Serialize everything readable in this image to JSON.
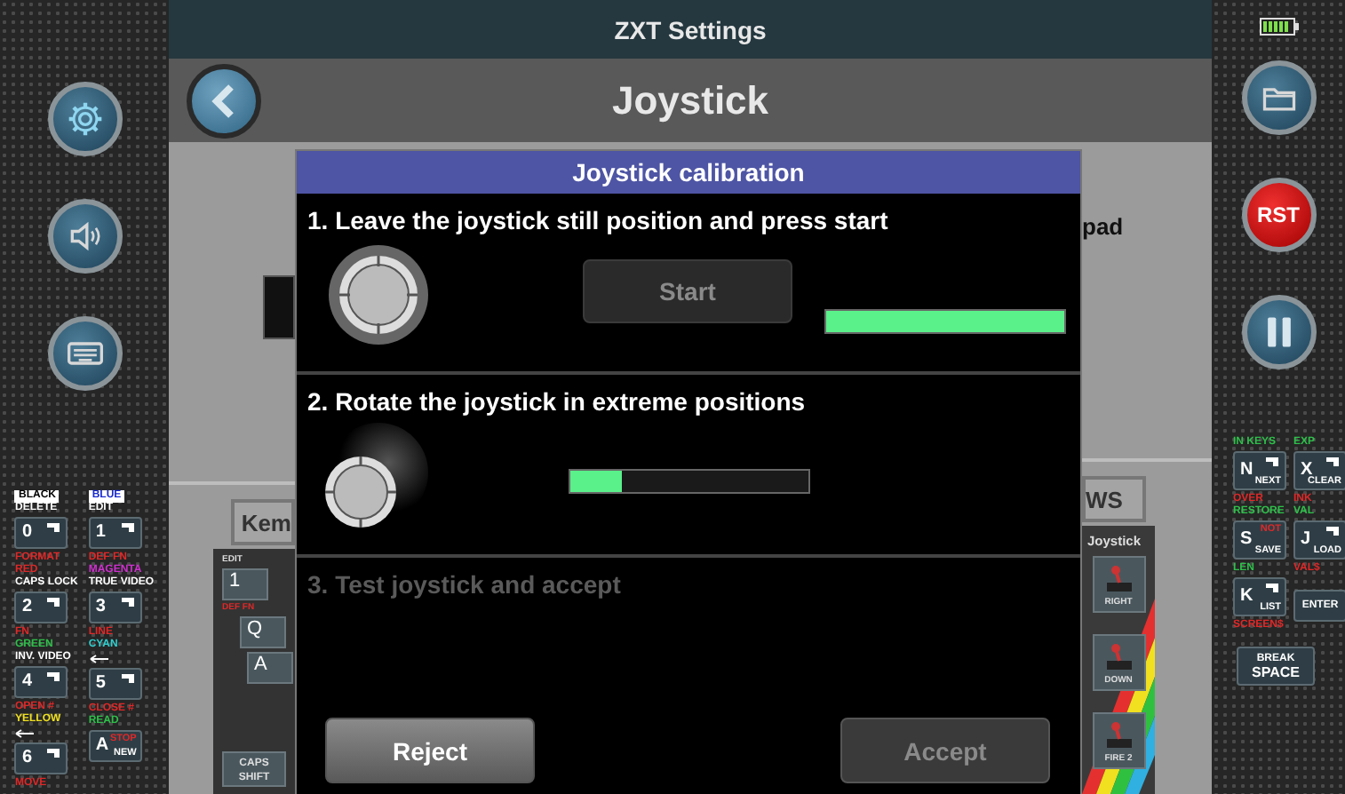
{
  "status_bar": {
    "title": "ZXT Settings"
  },
  "header": {
    "title": "Joystick"
  },
  "reset_button": {
    "label": "RST"
  },
  "keyboard_left": {
    "columns": [
      [
        {
          "kind": "tag",
          "text": "BLACK",
          "color": "#000000"
        },
        {
          "kind": "label",
          "text": "DELETE",
          "color": "#ffffff"
        },
        {
          "kind": "key",
          "key": "0"
        },
        {
          "kind": "label",
          "text": "FORMAT",
          "color": "#e02828"
        },
        {
          "kind": "label",
          "text": "RED",
          "color": "#e02828"
        },
        {
          "kind": "label",
          "text": "CAPS LOCK",
          "color": "#ffffff"
        },
        {
          "kind": "key",
          "key": "2"
        },
        {
          "kind": "label",
          "text": "FN",
          "color": "#e02828"
        },
        {
          "kind": "label",
          "text": "GREEN",
          "color": "#2ec04a"
        },
        {
          "kind": "label",
          "text": "INV. VIDEO",
          "color": "#ffffff"
        },
        {
          "kind": "key",
          "key": "4"
        },
        {
          "kind": "label",
          "text": "OPEN #",
          "color": "#e02828"
        },
        {
          "kind": "label",
          "text": "YELLOW",
          "color": "#f0e020"
        },
        {
          "kind": "arrow"
        },
        {
          "kind": "key",
          "key": "6"
        },
        {
          "kind": "label",
          "text": "MOVE",
          "color": "#e02828"
        }
      ],
      [
        {
          "kind": "tag",
          "text": "BLUE",
          "color": "#1a2ad0"
        },
        {
          "kind": "label",
          "text": "EDIT",
          "color": "#ffffff"
        },
        {
          "kind": "key",
          "key": "1"
        },
        {
          "kind": "label",
          "text": "DEF FN",
          "color": "#e02828"
        },
        {
          "kind": "label",
          "text": "MAGENTA",
          "color": "#d030d0"
        },
        {
          "kind": "label",
          "text": "TRUE VIDEO",
          "color": "#ffffff"
        },
        {
          "kind": "key",
          "key": "3"
        },
        {
          "kind": "label",
          "text": "LINE",
          "color": "#e02828"
        },
        {
          "kind": "label",
          "text": "CYAN",
          "color": "#30d0d0"
        },
        {
          "kind": "arrow"
        },
        {
          "kind": "key",
          "key": "5"
        },
        {
          "kind": "label",
          "text": "CLOSE #",
          "color": "#e02828"
        },
        {
          "kind": "label",
          "text": "READ",
          "color": "#2ec04a"
        },
        {
          "kind": "key",
          "key": "A",
          "top": "STOP",
          "bottom": "NEW"
        }
      ]
    ]
  },
  "keyboard_right": {
    "columns": [
      [
        {
          "kind": "label",
          "text": "IN KEYS",
          "color": "#2ec04a"
        },
        {
          "kind": "key",
          "key": "N",
          "bottom": "NEXT"
        },
        {
          "kind": "label",
          "text": "OVER",
          "color": "#e02828"
        },
        {
          "kind": "label",
          "text": "RESTORE",
          "color": "#2ec04a"
        },
        {
          "kind": "key",
          "key": "S",
          "top": "NOT",
          "bottom": "SAVE"
        },
        {
          "kind": "label",
          "text": "LEN",
          "color": "#2ec04a"
        },
        {
          "kind": "key",
          "key": "K",
          "bottom": "LIST"
        },
        {
          "kind": "label",
          "text": "SCREEN$",
          "color": "#e02828"
        }
      ],
      [
        {
          "kind": "label",
          "text": "EXP",
          "color": "#2ec04a"
        },
        {
          "kind": "key",
          "key": "X",
          "bottom": "CLEAR"
        },
        {
          "kind": "label",
          "text": "INK",
          "color": "#e02828"
        },
        {
          "kind": "label",
          "text": "VAL",
          "color": "#2ec04a"
        },
        {
          "kind": "key",
          "key": "J",
          "bottom": "LOAD"
        },
        {
          "kind": "label",
          "text": "VAL$",
          "color": "#e02828"
        },
        {
          "kind": "wide",
          "key": "ENTER"
        }
      ]
    ],
    "space_key": {
      "top": "BREAK",
      "bottom": "SPACE"
    }
  },
  "settings_page": {
    "label_fragment": "pad",
    "left_field": "Kem",
    "right_field": "WS",
    "keyboard": [
      {
        "kind": "label",
        "text": "EDIT"
      },
      {
        "kind": "key",
        "text": "1"
      },
      {
        "kind": "label",
        "text": "DEF FN"
      },
      {
        "kind": "key",
        "text": "Q"
      },
      {
        "kind": "key",
        "text": "A"
      },
      {
        "kind": "wide",
        "text": "CAPS SHIFT"
      }
    ],
    "joystick_panel": {
      "title": "Joystick",
      "keys": [
        "RIGHT",
        "DOWN",
        "FIRE 2"
      ]
    }
  },
  "dialog": {
    "title": "Joystick calibration",
    "steps": [
      {
        "kind": "still",
        "text": "1. Leave the joystick still position and press start",
        "disabled": false,
        "start_button": {
          "label": "Start",
          "disabled": true
        },
        "level": 1
      },
      {
        "kind": "rotate",
        "text": "2. Rotate the joystick in extreme positions",
        "disabled": false,
        "level": 0.22
      },
      {
        "kind": "test",
        "text": "3. Test joystick and accept",
        "disabled": true
      }
    ],
    "buttons": [
      {
        "label": "Reject",
        "disabled": false
      },
      {
        "label": "Accept",
        "disabled": true
      }
    ]
  }
}
